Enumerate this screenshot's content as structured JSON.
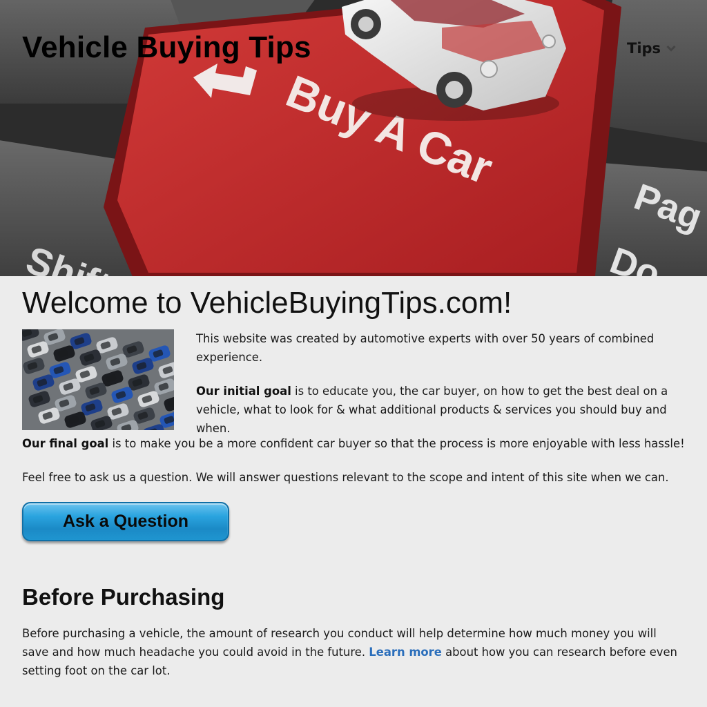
{
  "header": {
    "site_title": "Vehicle Buying Tips",
    "nav_tips_label": "Tips"
  },
  "hero": {
    "key_text": "Buy A Car",
    "key_shift_text": "Shift",
    "key_pagedown_text": "Pag",
    "key_pagedown_text2": "Do",
    "accent_color": "#c8282a"
  },
  "main": {
    "welcome_heading": "Welcome to VehicleBuyingTips.com!",
    "intro": "This website was created by automotive experts with over 50 years of combined experience.",
    "initial_goal_label": "Our initial goal",
    "initial_goal_text": " is to educate you, the car buyer, on how to get the best deal on a vehicle, what to look for & what additional products & services you should buy and when.",
    "final_goal_label": "Our final goal",
    "final_goal_text": " is to make you be a more confident car buyer so that the process is more enjoyable with less hassle!",
    "ask_intro": "Feel free to ask us a question. We will answer questions relevant to the scope and intent of this site when we can.",
    "ask_button_label": "Ask a Question",
    "ask_button_color": "#2aa4df"
  },
  "before_purchasing": {
    "heading": "Before Purchasing",
    "text_before_link": "Before purchasing a vehicle, the amount of research you conduct will help determine how much money you will save and how much headache you could avoid in the future. ",
    "link_label": "Learn more",
    "text_after_link": " about how you can research before even setting foot on the car lot.",
    "link_color": "#2a6ebb"
  }
}
